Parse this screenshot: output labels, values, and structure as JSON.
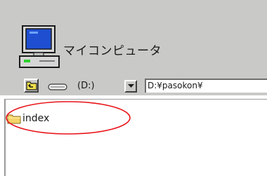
{
  "window": {
    "title": "マイコンピュータ",
    "icon": "computer-icon"
  },
  "toolbar": {
    "up_icon": "up-folder-icon",
    "drive_icon": "drive-icon",
    "drive_label": "(D:)",
    "dropdown_icon": "chevron-down-icon",
    "path_value": "D:¥pasokon¥"
  },
  "files": {
    "items": [
      {
        "name": "index",
        "icon": "folder-icon"
      }
    ]
  },
  "annotation": {
    "highlight_color": "#e8131a"
  },
  "colors": {
    "chrome": "#c9c9c7",
    "folder": "#f5d46a"
  }
}
